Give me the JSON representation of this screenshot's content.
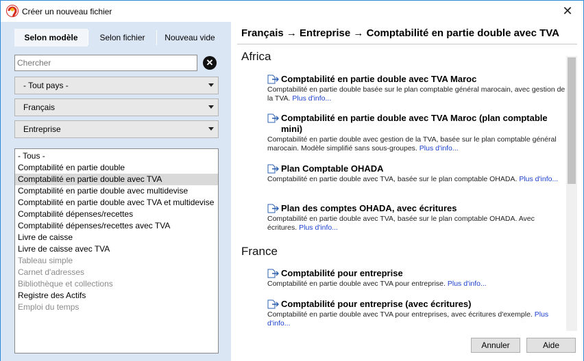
{
  "window": {
    "title": "Créer un nouveau fichier",
    "close_glyph": "✕",
    "app_icon": "app-logo-icon"
  },
  "tabs": [
    {
      "label": "Selon modèle",
      "active": true
    },
    {
      "label": "Selon fichier",
      "active": false
    },
    {
      "label": "Nouveau vide",
      "active": false
    }
  ],
  "search": {
    "placeholder": "Chercher",
    "value": "",
    "clear_icon": "clear-circle-icon"
  },
  "filters": {
    "country": "- Tout pays -",
    "language": "Français",
    "category": "Entreprise"
  },
  "template_types": [
    {
      "label": "- Tous -",
      "selected": false,
      "enabled": true
    },
    {
      "label": "Comptabilité en partie double",
      "selected": false,
      "enabled": true
    },
    {
      "label": "Comptabilité en partie double avec TVA",
      "selected": true,
      "enabled": true
    },
    {
      "label": "Comptabilité en partie double avec multidevise",
      "selected": false,
      "enabled": true
    },
    {
      "label": "Comptabilité en partie double avec TVA et multidevise",
      "selected": false,
      "enabled": true
    },
    {
      "label": "Comptabilité dépenses/recettes",
      "selected": false,
      "enabled": true
    },
    {
      "label": "Comptabilité dépenses/recettes avec TVA",
      "selected": false,
      "enabled": true
    },
    {
      "label": "Livre de caisse",
      "selected": false,
      "enabled": true
    },
    {
      "label": "Livre de caisse avec TVA",
      "selected": false,
      "enabled": true
    },
    {
      "label": "Tableau simple",
      "selected": false,
      "enabled": false
    },
    {
      "label": "Carnet d'adresses",
      "selected": false,
      "enabled": false
    },
    {
      "label": "Bibliothèque et collections",
      "selected": false,
      "enabled": false
    },
    {
      "label": "Registre des Actifs",
      "selected": false,
      "enabled": true
    },
    {
      "label": "Emploi du temps",
      "selected": false,
      "enabled": false
    }
  ],
  "breadcrumb": "Français → Entreprise → Comptabilité en partie double avec TVA",
  "groups": [
    {
      "name": "Africa",
      "templates": [
        {
          "title": "Comptabilité en partie double avec TVA Maroc",
          "description": "Comptabilité en partie double basée sur le plan comptable général marocain, avec gestion de la TVA.",
          "more": "Plus d'info..."
        },
        {
          "title": "Comptabilité en partie double avec TVA Maroc (plan comptable mini)",
          "description": "Comptabilité en partie double avec gestion de la TVA, basée sur le plan comptable général marocain. Modèle simplifié sans sous-groupes.",
          "more": "Plus d'info..."
        },
        {
          "title": "Plan Comptable OHADA",
          "description": "Comptabilité en partie double avec TVA, basée sur le plan comptable OHADA.",
          "more": "Plus d'info..."
        },
        {
          "title": "Plan des comptes OHADA, avec écritures",
          "description": "Comptabilité en partie double avec TVA, basée sur le plan comptable OHADA. Avec écritures.",
          "more": "Plus d'info..."
        }
      ]
    },
    {
      "name": "France",
      "templates": [
        {
          "title": "Comptabilité pour entreprise",
          "description": "Comptabilité en partie double avec TVA pour entreprise.",
          "more": "Plus d'info..."
        },
        {
          "title": "Comptabilité pour entreprise (avec écritures)",
          "description": "Comptabilité en partie double avec TVA pour entreprises, avec écritures d'exemple.",
          "more": "Plus d'info..."
        }
      ]
    }
  ],
  "buttons": {
    "cancel": "Annuler",
    "help": "Aide"
  }
}
